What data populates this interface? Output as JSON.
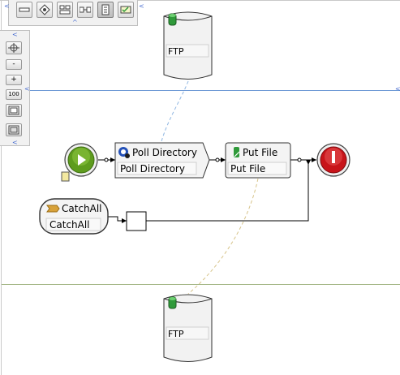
{
  "toolbar": {
    "buttons": [
      {
        "name": "line-tool-icon"
      },
      {
        "name": "eye-tool-icon"
      },
      {
        "name": "split-tool-icon"
      },
      {
        "name": "sequence-tool-icon"
      },
      {
        "name": "document-tool-icon",
        "active": true
      },
      {
        "name": "check-tool-icon"
      }
    ]
  },
  "zoom": {
    "fit_icon": "fit-icon",
    "zoom_out": "-",
    "zoom_in": "+",
    "actual": "100",
    "page_icon": "page-icon",
    "window_icon": "window-icon"
  },
  "nodes": {
    "ftp_top": {
      "label": "FTP"
    },
    "ftp_bottom": {
      "label": "FTP"
    },
    "poll": {
      "title": "Poll Directory",
      "name": "Poll Directory"
    },
    "put": {
      "title": "Put File",
      "name": "Put File"
    },
    "catch": {
      "title": "CatchAll",
      "name": "CatchAll"
    }
  },
  "colors": {
    "lane_blue": "#6f9bd6",
    "lane_green": "#a7b98a",
    "start_green": "#5e9c1e",
    "stop_red": "#c8141a",
    "db_green": "#2f9a3a"
  }
}
